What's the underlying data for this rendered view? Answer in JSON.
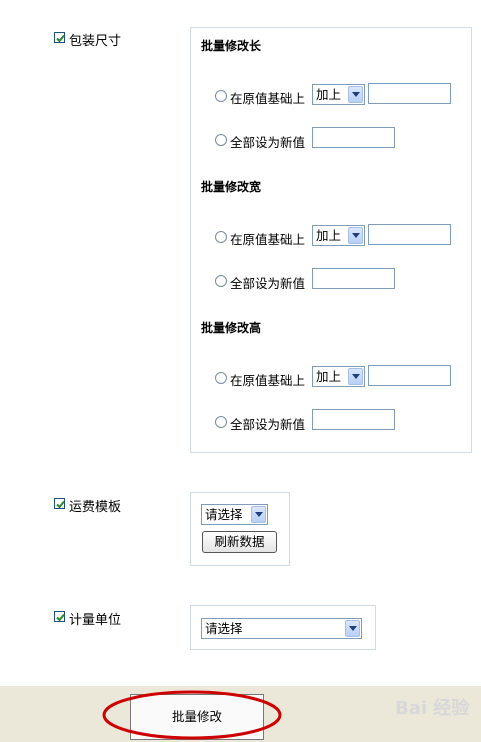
{
  "package_size": {
    "checkbox_label": "包装尺寸",
    "checked": true,
    "sections": [
      {
        "title": "批量修改长",
        "option_base": "在原值基础上",
        "op_value": "加上",
        "option_all": "全部设为新值"
      },
      {
        "title": "批量修改宽",
        "option_base": "在原值基础上",
        "op_value": "加上",
        "option_all": "全部设为新值"
      },
      {
        "title": "批量修改高",
        "option_base": "在原值基础上",
        "op_value": "加上",
        "option_all": "全部设为新值"
      }
    ]
  },
  "shipping_template": {
    "checkbox_label": "运费模板",
    "checked": true,
    "select_value": "请选择",
    "refresh_label": "刷新数据"
  },
  "unit": {
    "checkbox_label": "计量单位",
    "checked": true,
    "select_value": "请选择"
  },
  "footer": {
    "submit_label": "批量修改",
    "watermark": "Bai 经验"
  },
  "colors": {
    "checkmark": "#2a8a2a",
    "footer_bg": "#ebe7d9",
    "highlight_ellipse": "#cc0000"
  }
}
